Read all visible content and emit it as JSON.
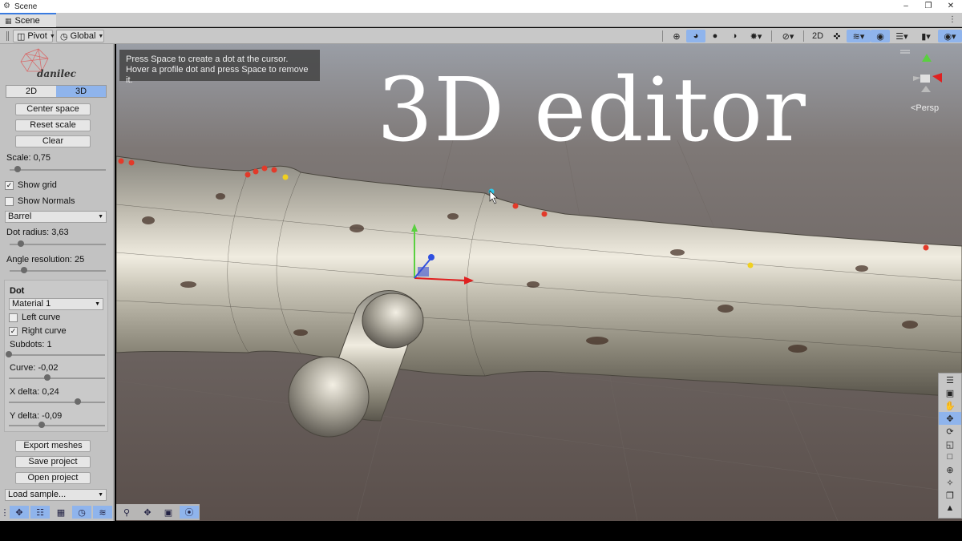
{
  "window": {
    "title": "Scene",
    "app_icon": "unity-icon",
    "controls": [
      "minimize-icon",
      "restore-icon",
      "close-icon"
    ]
  },
  "tab": {
    "label": "Scene",
    "icon": "grid-icon"
  },
  "toolbar": {
    "pivot": "Pivot",
    "global": "Global",
    "mode_2d": "2D"
  },
  "panel": {
    "logo_text": "danilec",
    "seg_2d": "2D",
    "seg_3d": "3D",
    "center_space": "Center space",
    "reset_scale": "Reset scale",
    "clear": "Clear",
    "scale_label": "Scale: 0,75",
    "scale_value": 0.08,
    "show_grid": "Show grid",
    "show_grid_checked": true,
    "show_normals": "Show Normals",
    "show_normals_checked": false,
    "preset": "Barrel",
    "dot_radius_label": "Dot radius: 3,63",
    "dot_radius_value": 0.12,
    "angle_resolution_label": "Angle resolution: 25",
    "angle_resolution_value": 0.15,
    "dot": {
      "header": "Dot",
      "material": "Material 1",
      "left_curve": "Left curve",
      "left_curve_checked": false,
      "right_curve": "Right curve",
      "right_curve_checked": true,
      "subdots_label": "Subdots: 1",
      "subdots_value": 0.0,
      "curve_label": "Curve: -0,02",
      "curve_value": 0.4,
      "xdelta_label": "X delta: 0,24",
      "xdelta_value": 0.72,
      "ydelta_label": "Y delta: -0,09",
      "ydelta_value": 0.34
    },
    "export_meshes": "Export meshes",
    "save_project": "Save project",
    "open_project": "Open project",
    "load_sample": "Load sample..."
  },
  "viewport": {
    "tooltip_line1": "Press Space to create a dot at the cursor.",
    "tooltip_line2": "Hover a profile dot and press Space to remove it.",
    "overlay_title": "3D editor",
    "persp_label": "<Persp"
  },
  "colors": {
    "accent": "#8fb4ec",
    "panel_bg": "#c2c2c2",
    "dot_red": "#e23a2a",
    "dot_yellow": "#f0d020",
    "dot_cyan": "#30c8e8"
  }
}
